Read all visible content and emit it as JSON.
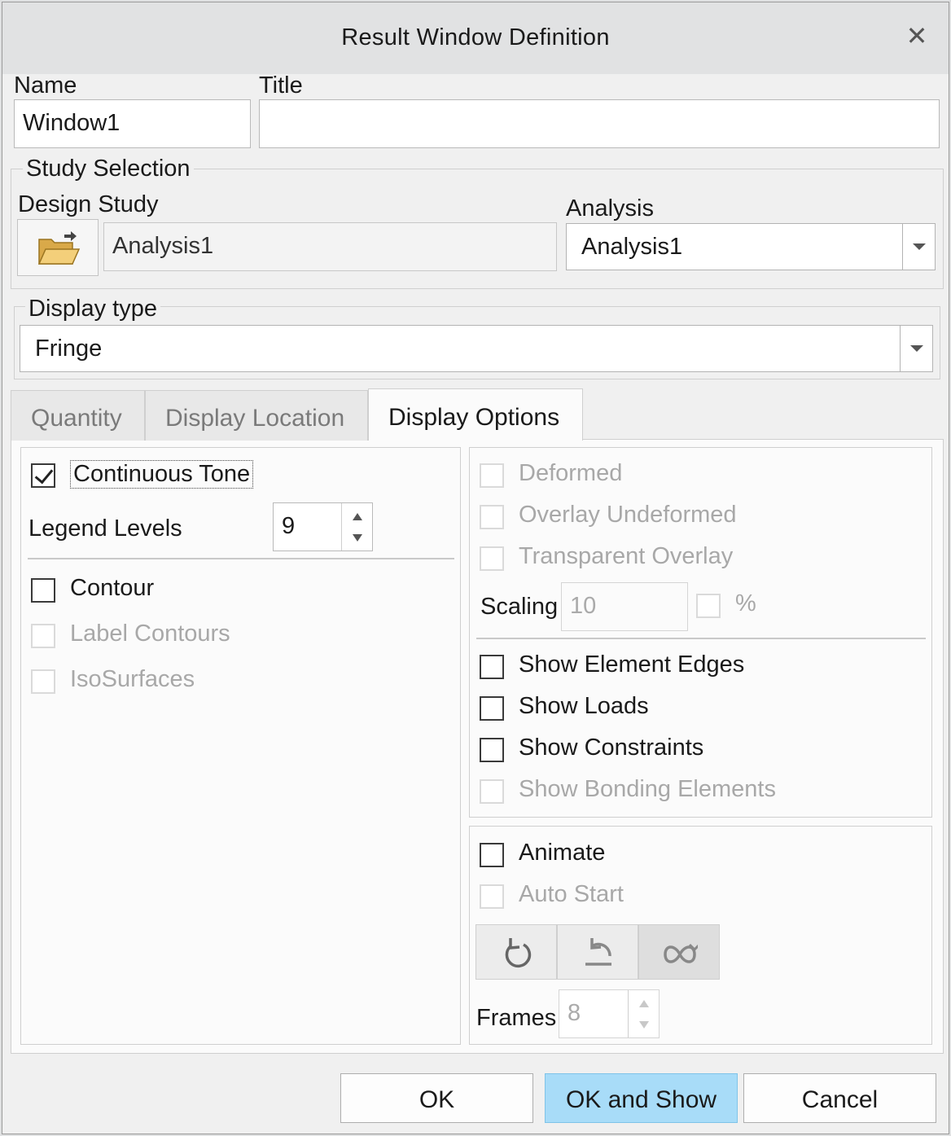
{
  "window": {
    "title": "Result Window Definition"
  },
  "fields": {
    "name_label": "Name",
    "name_value": "Window1",
    "title_label": "Title",
    "title_value": ""
  },
  "study_selection": {
    "legend": "Study Selection",
    "design_study_label": "Design Study",
    "design_study_value": "Analysis1",
    "analysis_label": "Analysis",
    "analysis_value": "Analysis1"
  },
  "display_type": {
    "legend": "Display type",
    "value": "Fringe"
  },
  "tabs": [
    {
      "label": "Quantity"
    },
    {
      "label": "Display Location"
    },
    {
      "label": "Display Options"
    }
  ],
  "left_panel": {
    "continuous_tone": {
      "label": "Continuous Tone",
      "checked": true
    },
    "legend_levels": {
      "label": "Legend Levels",
      "value": "9"
    },
    "contour": {
      "label": "Contour",
      "checked": false
    },
    "label_contours": {
      "label": "Label Contours",
      "enabled": false
    },
    "isosurfaces": {
      "label": "IsoSurfaces",
      "enabled": false
    }
  },
  "right_panel": {
    "deformed": {
      "label": "Deformed",
      "enabled": false
    },
    "overlay_undeformed": {
      "label": "Overlay Undeformed",
      "enabled": false
    },
    "transparent_overlay": {
      "label": "Transparent Overlay",
      "enabled": false
    },
    "scaling": {
      "label": "Scaling",
      "value": "10",
      "percent_label": "%"
    },
    "show_element_edges": {
      "label": "Show Element Edges"
    },
    "show_loads": {
      "label": "Show Loads"
    },
    "show_constraints": {
      "label": "Show Constraints"
    },
    "show_bonding_elements": {
      "label": "Show Bonding Elements",
      "enabled": false
    }
  },
  "animation": {
    "animate": {
      "label": "Animate"
    },
    "auto_start": {
      "label": "Auto Start",
      "enabled": false
    },
    "frames": {
      "label": "Frames",
      "value": "8"
    },
    "buttons": [
      "repeat-icon",
      "reverse-icon",
      "ping-pong-icon"
    ]
  },
  "footer": {
    "ok": "OK",
    "ok_and_show": "OK and Show",
    "cancel": "Cancel"
  }
}
